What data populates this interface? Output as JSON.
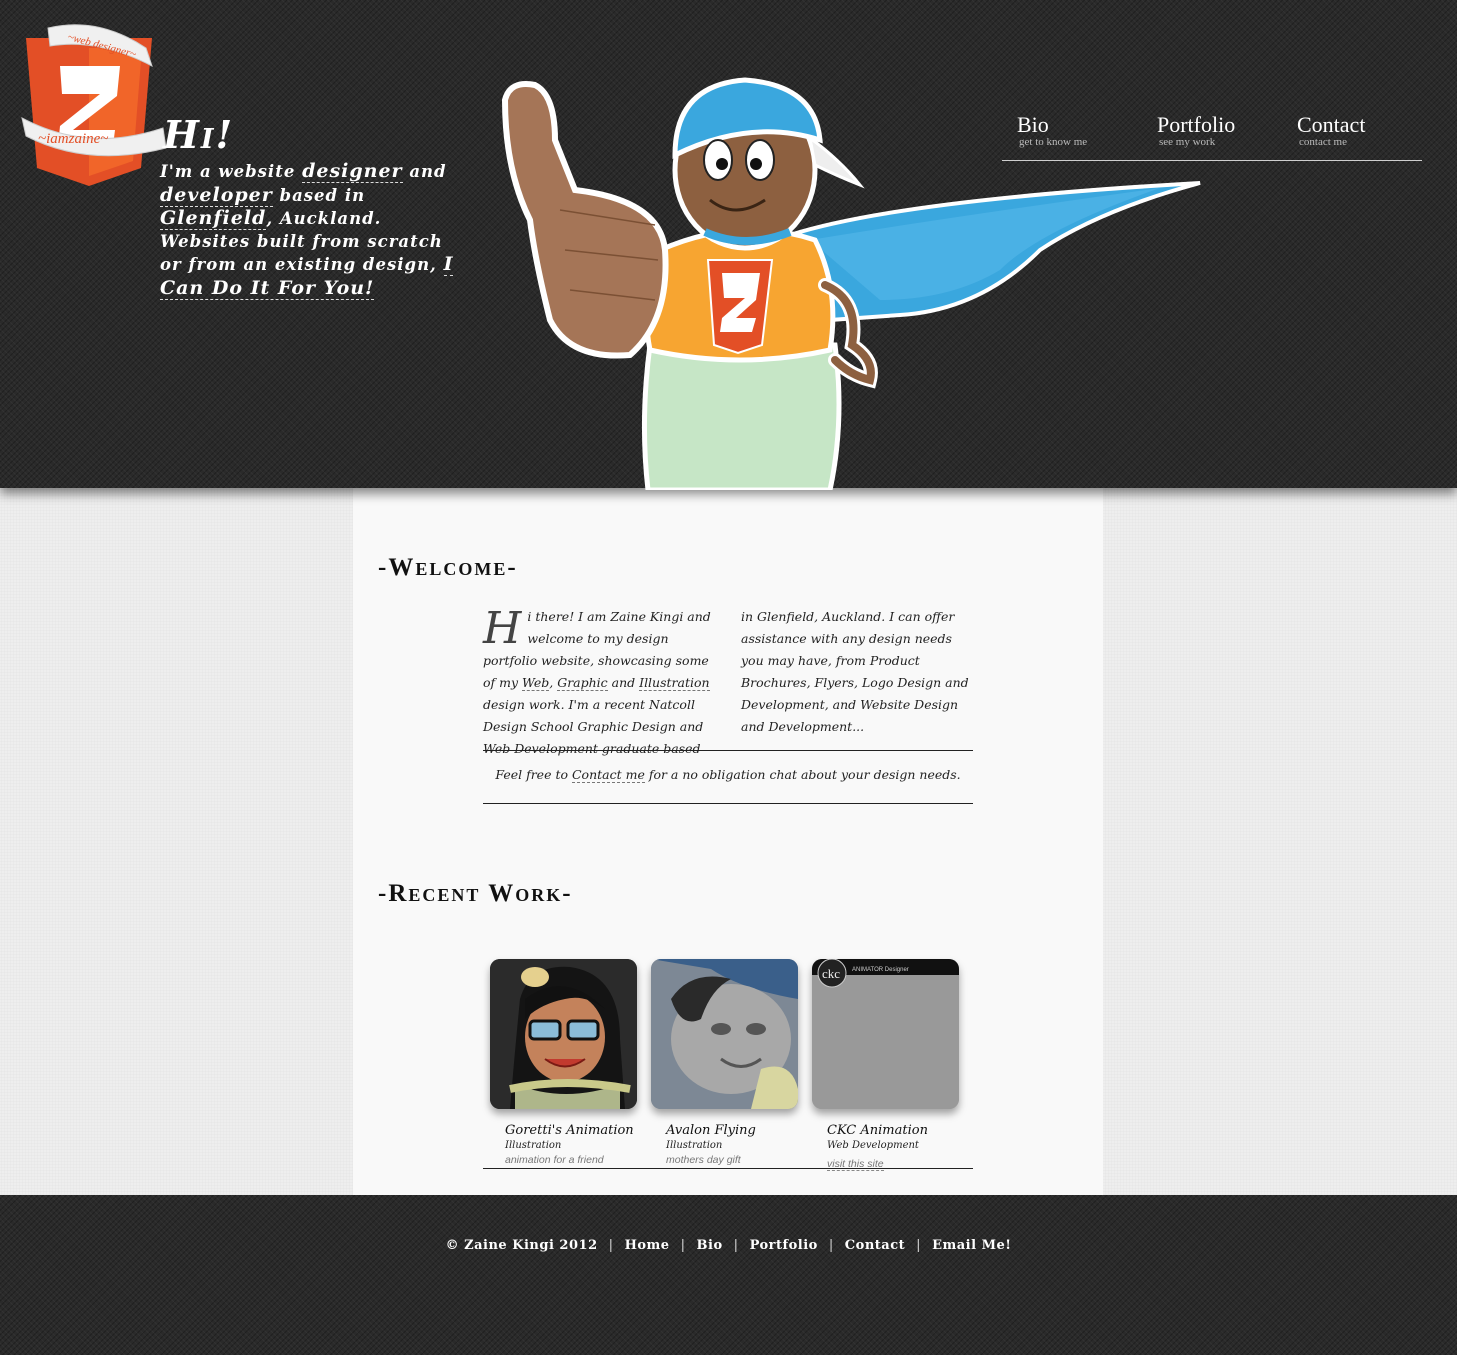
{
  "header": {
    "logo": {
      "banner_top": "~web designer~",
      "banner_bottom": "~iamzaine~"
    },
    "greeting": "Hi!",
    "intro": {
      "p1": "I'm a website ",
      "designer": "designer",
      "p2": " and ",
      "developer": "developer",
      "p3": " based in ",
      "glenfield": "Glenfield",
      "p4": ", Auckland. Websites built from scratch or from an existing design, ",
      "cta": "I Can Do It For You!"
    },
    "nav": [
      {
        "title": "Bio",
        "subtitle": "get to know me"
      },
      {
        "title": "Portfolio",
        "subtitle": "see my work"
      },
      {
        "title": "Contact",
        "subtitle": "contact me"
      }
    ]
  },
  "welcome": {
    "title": "-Welcome-",
    "dropcap": "H",
    "p1": "i there! I am Zaine Kingi and welcome to my design portfolio website, showcasing some of my ",
    "web": "Web",
    "p2": ", ",
    "graphic": "Graphic",
    "p3": " and ",
    "illustration": "Illustration",
    "p4": " design work. I'm a recent Natcoll Design School Graphic Design and Web Development graduate based in Glenfield, Auckland. I can offer assistance with any design needs you may have, from Product Brochures, Flyers, Logo Design and Development, and Website Design and Development...",
    "feel_pre": "Feel free to ",
    "feel_link": "Contact me",
    "feel_post": " for a no obligation chat about your design needs."
  },
  "recent_work": {
    "title": "-Recent Work-",
    "items": [
      {
        "title": "Goretti's Animation",
        "category": "Illustration",
        "description": "animation for a friend"
      },
      {
        "title": "Avalon Flying",
        "category": "Illustration",
        "description": "mothers day gift"
      },
      {
        "title": "CKC Animation",
        "category": "Web Development",
        "description": "visit this site",
        "thumb_brand": "ckc",
        "thumb_caption": "ANIMATOR Designer"
      }
    ]
  },
  "footer": {
    "copyright": "© Zaine Kingi 2012",
    "links": [
      "Home",
      "Bio",
      "Portfolio",
      "Contact",
      "Email Me!"
    ],
    "separator": "|"
  },
  "colors": {
    "header_bg": "#2a2a2a",
    "html5_orange": "#e34f26",
    "cape_blue": "#3aa7de",
    "shirt_orange": "#f7a531",
    "content_bg": "#f9f9f9"
  }
}
